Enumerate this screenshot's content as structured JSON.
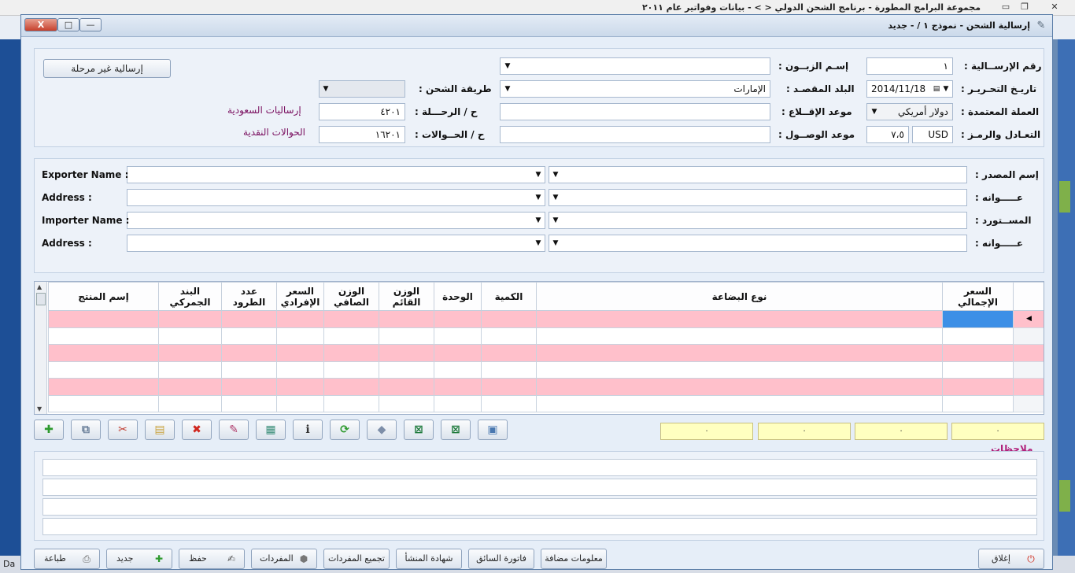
{
  "background": {
    "title": "مجموعة البرامج المطورة - برنامج الشحن الدولي < > - بيانات وفواتير عام ٢٠١١",
    "status_left": "Da"
  },
  "window": {
    "title": "إرسالية الشحن - نموذج ١ / - جديد",
    "close_label": "X",
    "max_label": "□",
    "min_label": "—"
  },
  "header": {
    "shipment_no_label": "رقم الإرســالية :",
    "shipment_no_value": "١",
    "customer_label": "إسـم الزبــون :",
    "customer_value": "",
    "not_forwarded_button": "إرسالية غير مرحلة",
    "edit_date_label": "تاريـخ التحـريـر :",
    "edit_date_value": "2014/11/18",
    "destination_label": "البلد المقصـد :",
    "destination_value": "الإمارات",
    "shipping_method_label": "طريقة الشحن :",
    "shipping_method_value": "",
    "currency_label": "العملة المعتمدة :",
    "currency_value": "دولار أمريكي",
    "departure_label": "موعد الإقــلاع :",
    "departure_value": "",
    "trip_label": "ح / الرحـــلة :",
    "trip_value": "٤٢٠١",
    "saudi_shipments_link": "إرساليات السعودية",
    "exchange_label": "التعـادل والرمـز :",
    "currency_code": "USD",
    "exchange_rate": "٧،٥",
    "arrival_label": "موعد الوصــول :",
    "arrival_value": "",
    "transfers_label": "ح / الحــوالات :",
    "transfers_value": "١٦٢٠١",
    "cash_transfers_link": "الحوالات النقدية"
  },
  "parties": {
    "exporter_ar_label": "إسم المصدر :",
    "exporter_en_label": "Exporter Name :",
    "address1_ar_label": "عـــــوانه :",
    "address1_en_label": "Address :",
    "importer_ar_label": "المســتورد :",
    "importer_en_label": "Importer Name :",
    "address2_ar_label": "عـــــوانه :",
    "address2_en_label": "Address :"
  },
  "grid": {
    "columns": [
      "السعر الإجمالي",
      "نوع البضاعة",
      "الكمية",
      "الوحدة",
      "الوزن القائم",
      "الوزن الصافي",
      "السعر الإفرادي",
      "عدد الطرود",
      "البند الجمركي",
      "إسم المنتج"
    ],
    "row_count": 6
  },
  "totals": [
    "٠",
    "٠",
    "٠",
    "٠"
  ],
  "toolbar_icons": [
    "add-icon",
    "copy-icon",
    "cut-icon",
    "paste-icon",
    "delete-icon",
    "tools-icon",
    "calculator-icon",
    "info-icon",
    "refresh-icon",
    "eraser-icon",
    "excel-export-icon",
    "excel-import-icon",
    "screen-icon"
  ],
  "notes": {
    "label": "ملاحظات"
  },
  "footer": {
    "close_button": "إغلاق",
    "extra_info_button": "معلومات مضافة",
    "driver_invoice_button": "فاتورة السائق",
    "origin_cert_button": "شهادة المنشأ",
    "group_items_button": "تجميع المفردات",
    "items_button": "المفردات",
    "save_button": "حفظ",
    "new_button": "جديد",
    "print_button": "طباعة"
  },
  "colors": {
    "pink_row": "#ffc0cb",
    "selected_cell": "#3d8fe6",
    "totals_bg": "#ffffc0",
    "link_color": "#7a1060"
  }
}
